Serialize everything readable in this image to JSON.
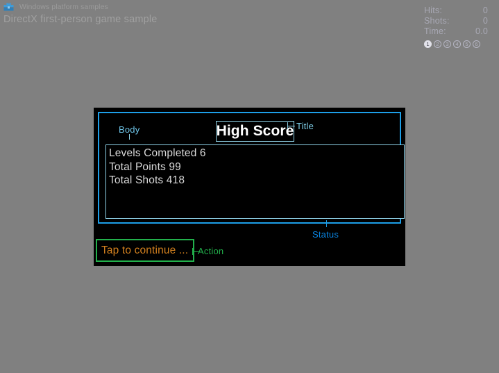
{
  "window": {
    "titlebar_text": "Windows platform samples",
    "app_icon": "toolbox-icon",
    "subtitle": "DirectX first-person game sample",
    "background_color": "#808080"
  },
  "hud": {
    "rows": [
      {
        "label": "Hits:",
        "value": "0"
      },
      {
        "label": "Shots:",
        "value": "0"
      },
      {
        "label": "Time:",
        "value": "0.0"
      }
    ],
    "levels": [
      {
        "number": "1",
        "active": true
      },
      {
        "number": "2",
        "active": false
      },
      {
        "number": "3",
        "active": false
      },
      {
        "number": "4",
        "active": false
      },
      {
        "number": "5",
        "active": false
      },
      {
        "number": "6",
        "active": false
      }
    ],
    "text_color": "#a8a8b4"
  },
  "overlay": {
    "title": "High Score",
    "body_lines": [
      "Levels Completed 6",
      "Total Points 99",
      "Total Shots 418"
    ],
    "action_text": "Tap to continue ...",
    "colors": {
      "panel_background": "#000000",
      "status_border": "#1d9fe8",
      "title_border": "#8fd2e8",
      "body_border": "#8fd2e8",
      "action_border": "#22b14c",
      "action_text": "#d2801e",
      "body_text": "#d8d8d8",
      "title_text": "#ffffff"
    }
  },
  "callouts": {
    "title": "Title",
    "body": "Body",
    "status": "Status",
    "action": "Action"
  }
}
